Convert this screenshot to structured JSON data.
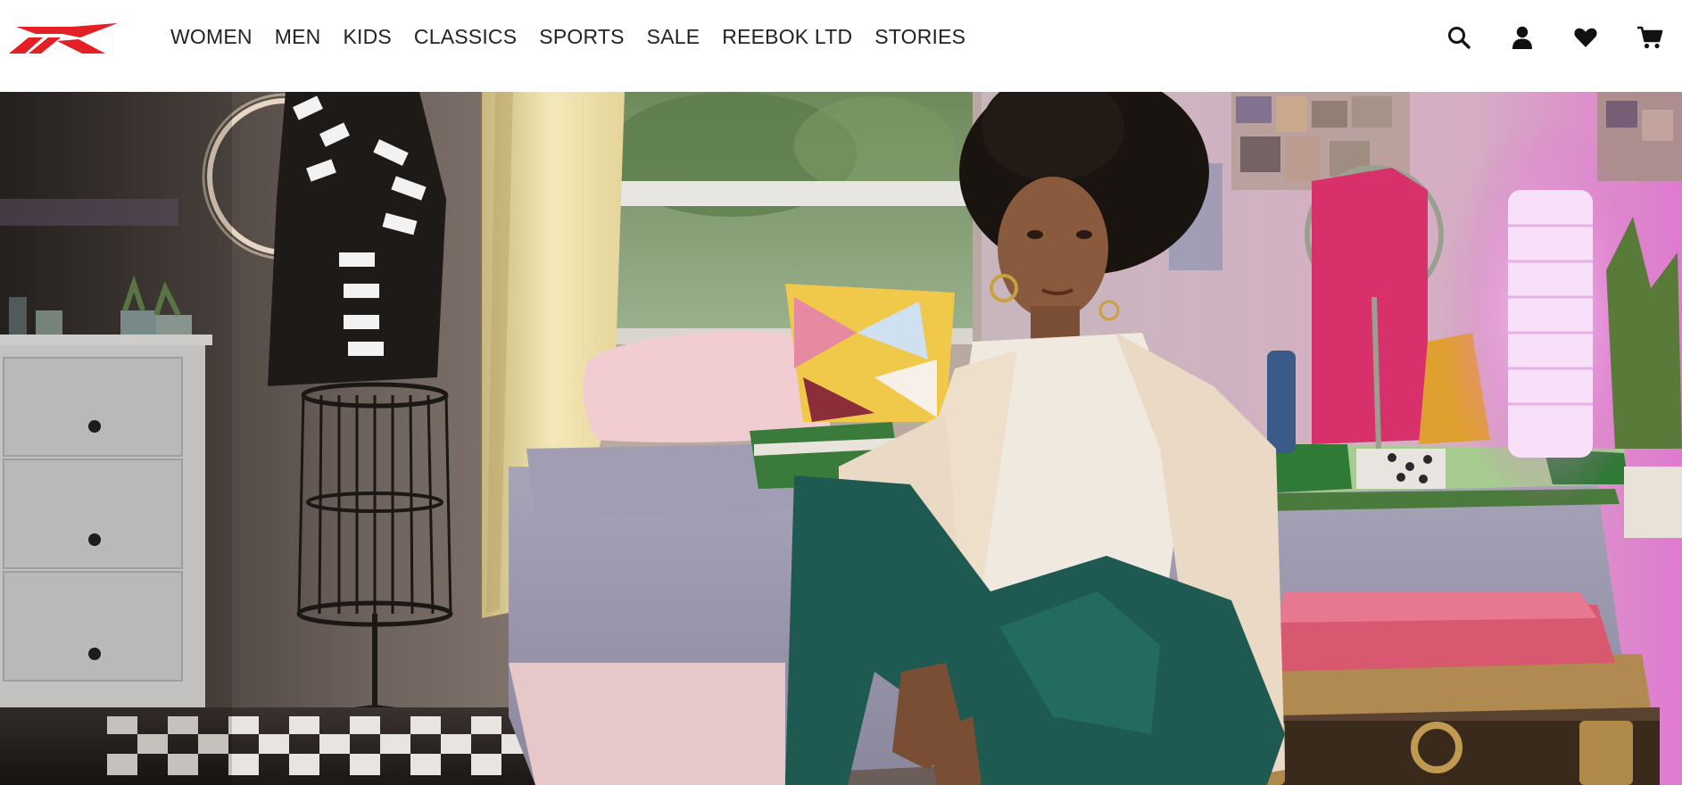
{
  "brand": {
    "logo_name": "reebok-vector-logo",
    "logo_color": "#e41f25"
  },
  "nav": {
    "items": [
      {
        "label": "WOMEN"
      },
      {
        "label": "MEN"
      },
      {
        "label": "KIDS"
      },
      {
        "label": "CLASSICS"
      },
      {
        "label": "SPORTS"
      },
      {
        "label": "SALE"
      },
      {
        "label": "REEBOK LTD"
      },
      {
        "label": "STORIES"
      }
    ]
  },
  "utilities": {
    "icons": [
      "search-icon",
      "account-icon",
      "wishlist-heart-icon",
      "cart-icon"
    ]
  },
  "hero": {
    "image_subject": "model seated on a trunk at the foot of a bed in a bedroom"
  },
  "colors": {
    "header_bg": "#ffffff",
    "nav_text": "#222222",
    "icon": "#111111",
    "brand_red": "#e41f25"
  }
}
